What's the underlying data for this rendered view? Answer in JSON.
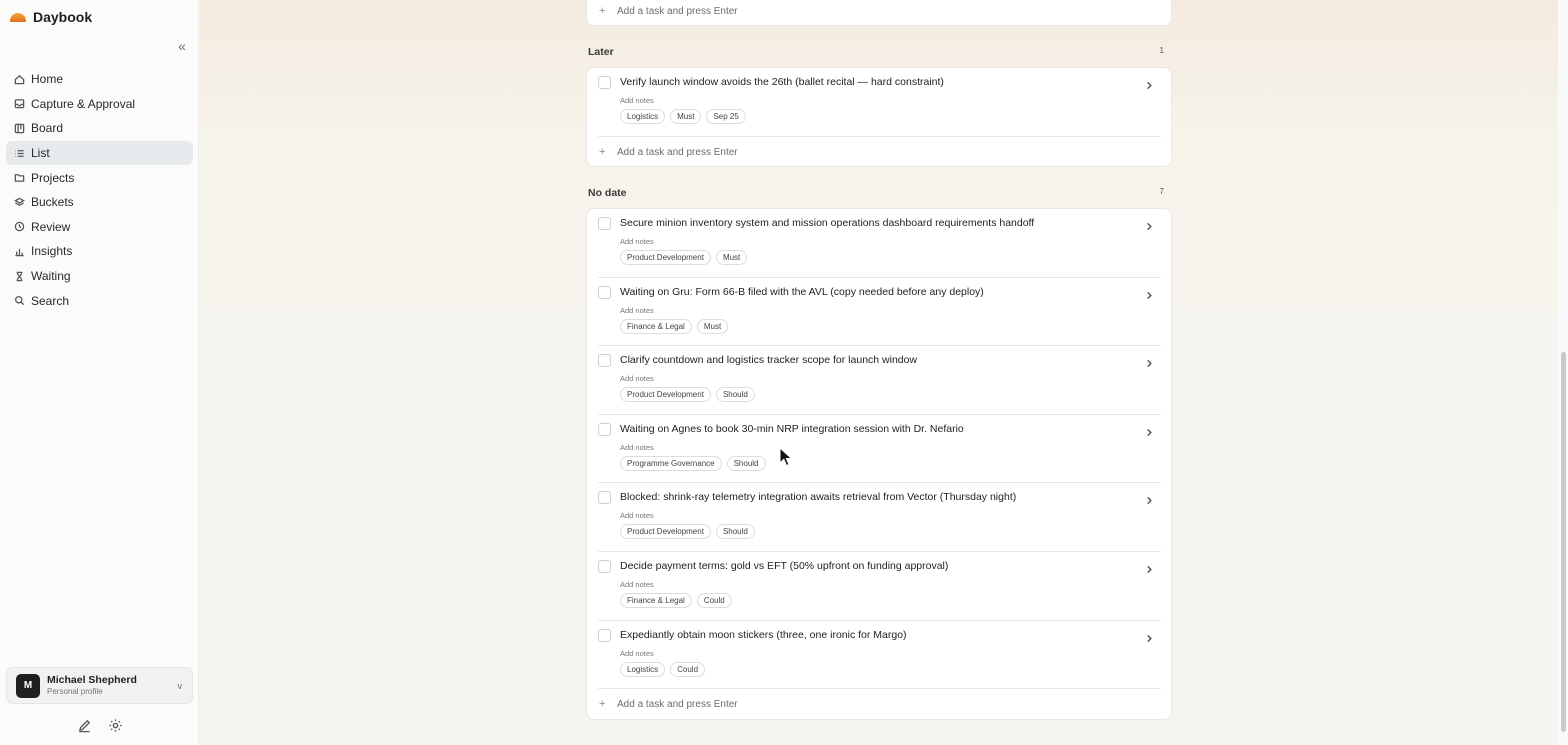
{
  "app": {
    "name": "Daybook"
  },
  "sidebar": {
    "items": [
      {
        "label": "Home",
        "icon": "home-icon"
      },
      {
        "label": "Capture & Approval",
        "icon": "inbox-icon"
      },
      {
        "label": "Board",
        "icon": "board-icon"
      },
      {
        "label": "List",
        "icon": "list-icon",
        "active": true
      },
      {
        "label": "Projects",
        "icon": "folder-icon"
      },
      {
        "label": "Buckets",
        "icon": "layers-icon"
      },
      {
        "label": "Review",
        "icon": "history-icon"
      },
      {
        "label": "Waiting",
        "icon": "hourglass-icon"
      },
      {
        "label": "Search",
        "icon": "search-icon"
      }
    ],
    "profile": {
      "initial": "M",
      "name": "Michael Shepherd",
      "subtitle": "Personal profile"
    }
  },
  "main": {
    "add_task_placeholder": "Add a task and press Enter",
    "sections": [
      {
        "title": "Later",
        "count": "1",
        "tasks": [
          {
            "title": "Verify launch window avoids the 26th (ballet recital — hard constraint)",
            "notes": "Add notes",
            "tags": [
              "Logistics",
              "Must",
              "Sep 25"
            ]
          }
        ]
      },
      {
        "title": "No date",
        "count": "7",
        "tasks": [
          {
            "title": "Secure minion inventory system and mission operations dashboard requirements handoff",
            "notes": "Add notes",
            "tags": [
              "Product Development",
              "Must"
            ]
          },
          {
            "title": "Waiting on Gru: Form 66-B filed with the AVL (copy needed before any deploy)",
            "notes": "Add notes",
            "tags": [
              "Finance & Legal",
              "Must"
            ]
          },
          {
            "title": "Clarify countdown and logistics tracker scope for launch window",
            "notes": "Add notes",
            "tags": [
              "Product Development",
              "Should"
            ]
          },
          {
            "title": "Waiting on Agnes to book 30-min NRP integration session with Dr. Nefario",
            "notes": "Add notes",
            "tags": [
              "Programme Governance",
              "Should"
            ]
          },
          {
            "title": "Blocked: shrink-ray telemetry integration awaits retrieval from Vector (Thursday night)",
            "notes": "Add notes",
            "tags": [
              "Product Development",
              "Should"
            ]
          },
          {
            "title": "Decide payment terms: gold vs EFT (50% upfront on funding approval)",
            "notes": "Add notes",
            "tags": [
              "Finance & Legal",
              "Could"
            ]
          },
          {
            "title": "Expediantly obtain moon stickers (three, one ironic for Margo)",
            "notes": "Add notes",
            "tags": [
              "Logistics",
              "Could"
            ]
          }
        ]
      }
    ]
  }
}
